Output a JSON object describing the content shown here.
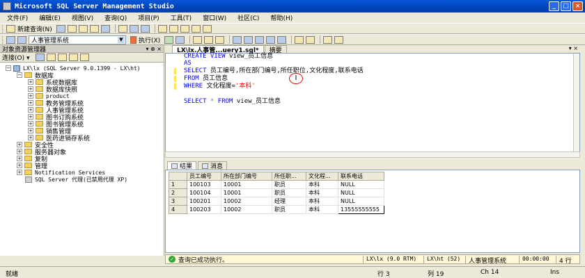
{
  "window": {
    "title": "Microsoft SQL Server Management Studio",
    "controls": [
      "_",
      "□",
      "×"
    ]
  },
  "menu": [
    "文件(F)",
    "编辑(E)",
    "视图(V)",
    "查询(Q)",
    "项目(P)",
    "工具(T)",
    "窗口(W)",
    "社区(C)",
    "帮助(H)"
  ],
  "toolbar1": {
    "new_query": "新建查询(N)"
  },
  "toolbar2": {
    "database": "人事管理系统",
    "execute": "执行(X)"
  },
  "object_explorer": {
    "title": "对象资源管理器",
    "pin_controls": "▾ ⊕ ×",
    "connect": "连接(O) ▾",
    "server": "LX\\lx (SQL Server 9.0.1399 - LX\\ht)",
    "databases_label": "数据库",
    "databases": [
      "系统数据库",
      "数据库快照",
      "product",
      "教务管理系统",
      "人事管理系统",
      "图书订购系统",
      "图书管理系统",
      "销售管理",
      "医药进销存系统"
    ],
    "other_nodes": [
      "安全性",
      "服务器对象",
      "复制",
      "管理",
      "Notification Services"
    ],
    "agent": "SQL Server 代理(已禁用代理 XP)"
  },
  "doc_tabs": [
    "LX\\lx.人事管...uery1.sql*",
    "摘要"
  ],
  "doc_tabs_controls": "▾ ×",
  "editor": {
    "line1_kw": "CREATE VIEW",
    "line1_rest": " view_员工信息",
    "line2_kw": "AS",
    "line3_kw": "SELECT",
    "line3_rest": " 员工编号,所在部门编号,所任职位,文化程度,联系电话",
    "line4_kw": "FROM",
    "line4_rest": " 员工信息",
    "line5_kw": "WHERE",
    "line5_rest": " 文化程度=",
    "line5_str": "'本科'",
    "line6_kw1": "SELECT",
    "line6_star": " * ",
    "line6_kw2": "FROM",
    "line6_rest": " view_员工信息",
    "cursor": "I"
  },
  "result_tabs": [
    "结果",
    "消息"
  ],
  "results": {
    "columns": [
      "员工编号",
      "所在部门编号",
      "所任职...",
      "文化程...",
      "联系电话"
    ],
    "rows": [
      [
        "1",
        "100103",
        "10001",
        "职员",
        "本科",
        "NULL"
      ],
      [
        "2",
        "100104",
        "10001",
        "职员",
        "本科",
        "NULL"
      ],
      [
        "3",
        "100201",
        "10002",
        "经理",
        "本科",
        "NULL"
      ],
      [
        "4",
        "100203",
        "10002",
        "职员",
        "本科",
        "13555555555"
      ]
    ]
  },
  "query_status": {
    "message": "查询已成功执行。",
    "server": "LX\\lx (9.0 RTM)",
    "user": "LX\\ht (52)",
    "database": "人事管理系统",
    "time": "00:00:00",
    "rows": "4 行"
  },
  "status_bar": {
    "ready": "就绪",
    "line": "行 3",
    "col": "列 19",
    "ch": "Ch 14",
    "ins": "Ins"
  }
}
